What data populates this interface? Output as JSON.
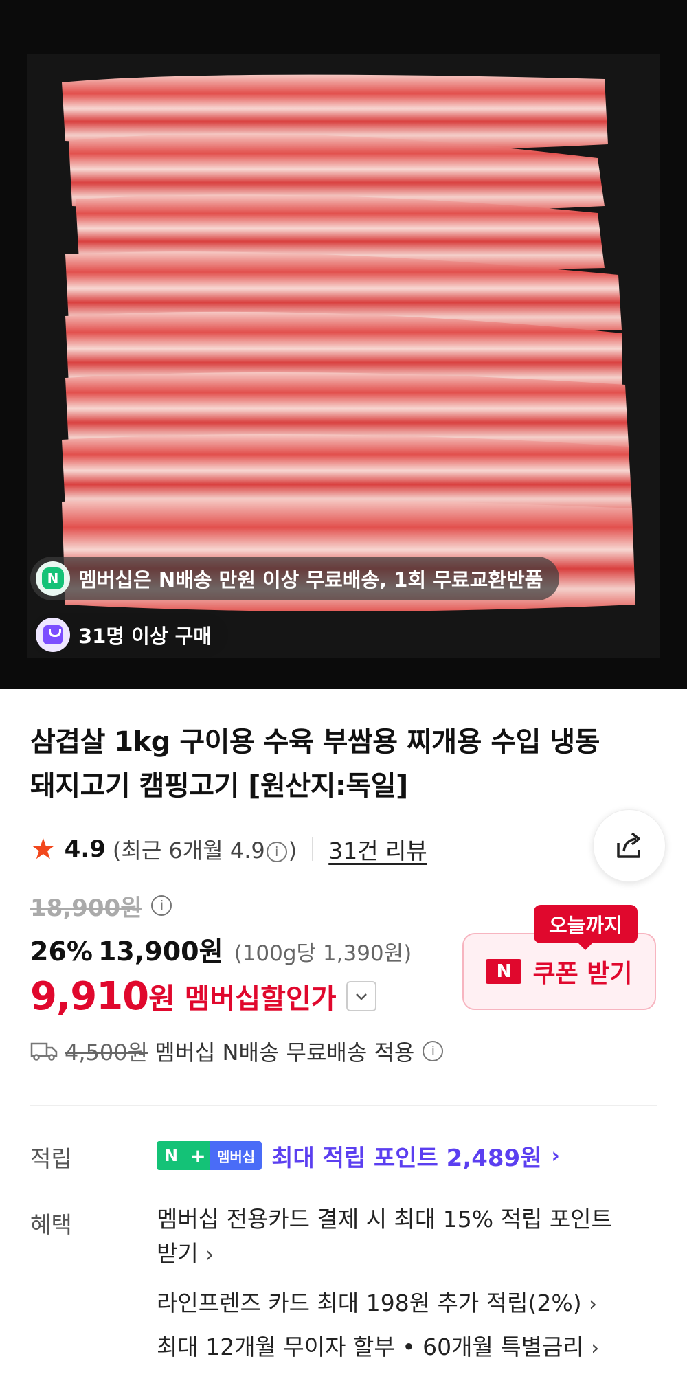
{
  "hero": {
    "pill_membership": "멤버십은 N배송 만원 이상 무료배송, 1회 무료교환반품",
    "pill_buyers": "31명 이상 구매"
  },
  "product": {
    "title": "삼겹살 1kg 구이용 수육 부쌈용 찌개용 수입 냉동 돼지고기 캠핑고기 [원산지:독일]",
    "rating": "4.9",
    "rating_recent_prefix": "(최근 6개월 4.9",
    "rating_recent_suffix": ")",
    "review_link": "31건 리뷰",
    "original_price": "18,900원",
    "discount": "26%",
    "price": "13,900원",
    "unit_price": "(100g당 1,390원)",
    "member_price_num": "9,910",
    "member_price_unit": "원",
    "member_price_label": "멤버십할인가"
  },
  "coupon": {
    "tag": "오늘까지",
    "logo": "N",
    "label": "쿠폰 받기"
  },
  "shipping": {
    "original_fee": "4,500원",
    "text": "멤버십 N배송 무료배송 적용"
  },
  "points": {
    "label": "적립",
    "chip_n": "N",
    "chip_plus": "+",
    "chip_text": "멤버십",
    "text": "최대 적립 포인트 2,489원"
  },
  "benefits": {
    "label": "혜택",
    "items": [
      "멤버십 전용카드 결제 시 최대 15% 적립 포인트 받기",
      "라인프렌즈 카드 최대 198원 추가 적립(2%)",
      "최대 12개월 무이자 할부 • 60개월 특별금리"
    ]
  },
  "colors": {
    "accent_red": "#e0082d",
    "points_purple": "#5b3ff0",
    "naver_green": "#14c277"
  }
}
